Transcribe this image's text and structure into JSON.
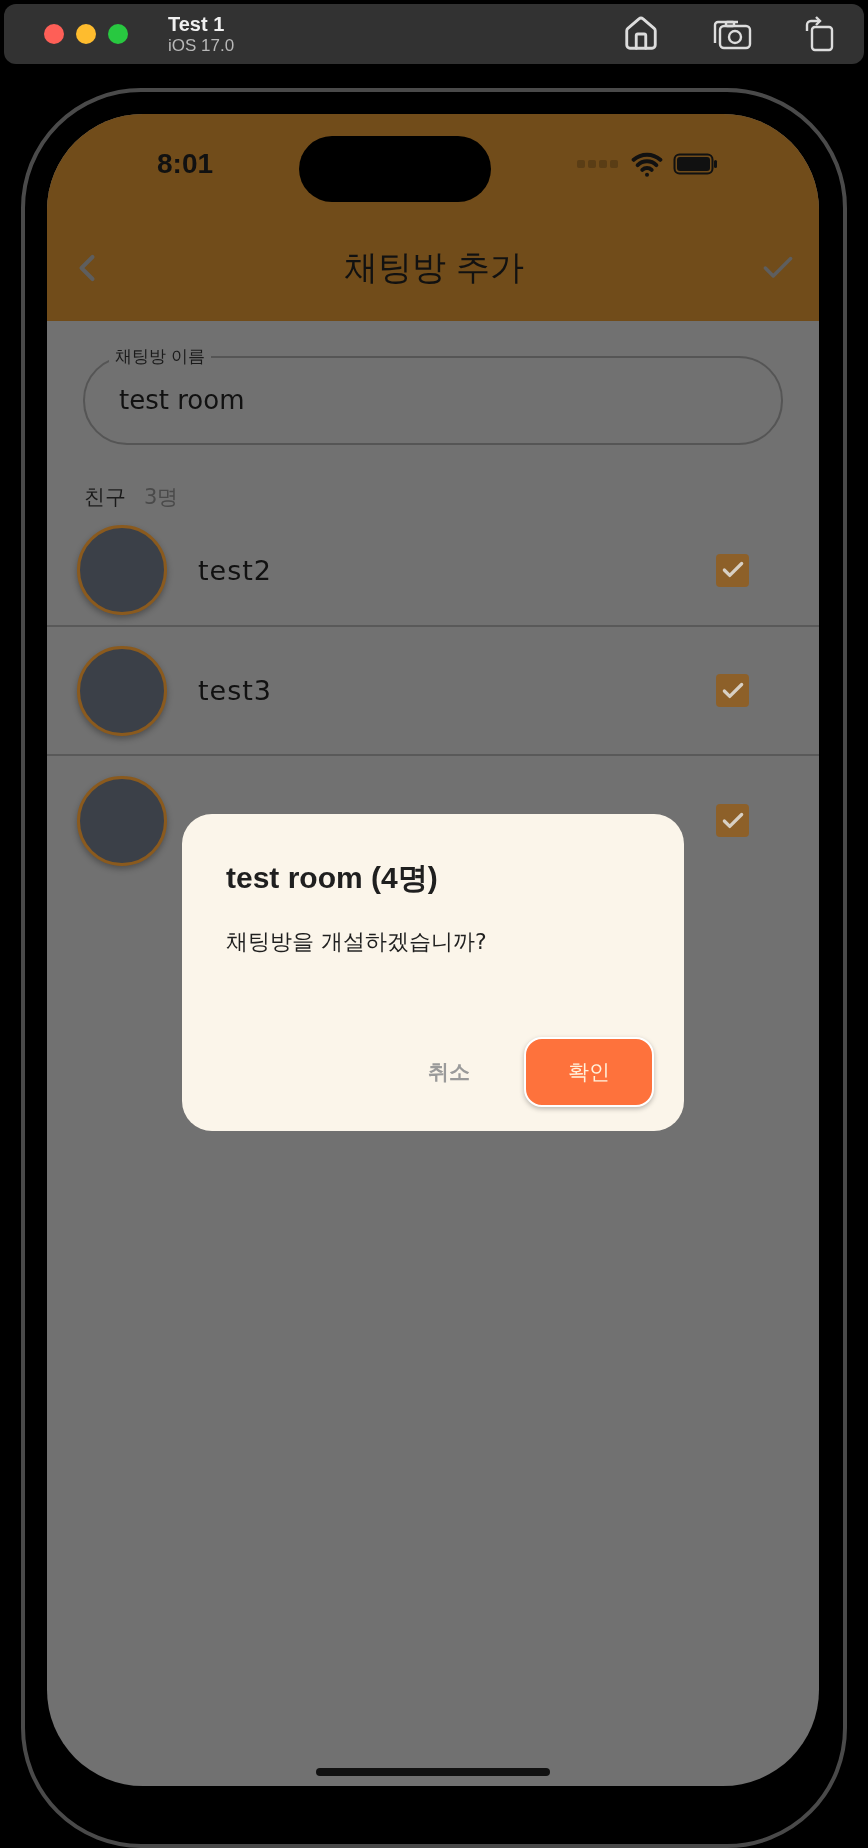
{
  "simulator": {
    "title": "Test 1",
    "subtitle": "iOS 17.0"
  },
  "status_bar": {
    "time": "8:01"
  },
  "app_bar": {
    "title": "채팅방 추가"
  },
  "room_name_field": {
    "label": "채팅방 이름",
    "value": "test room"
  },
  "friends": {
    "label": "친구",
    "count": "3명",
    "items": [
      {
        "name": "test2",
        "checked": true
      },
      {
        "name": "test3",
        "checked": true
      },
      {
        "checked": true
      }
    ]
  },
  "dialog": {
    "title": "test room (4명)",
    "message": "채팅방을 개설하겠습니까?",
    "buttons": [
      {
        "label": "취소",
        "kind": "text"
      },
      {
        "label": "확인",
        "kind": "filled"
      }
    ]
  }
}
